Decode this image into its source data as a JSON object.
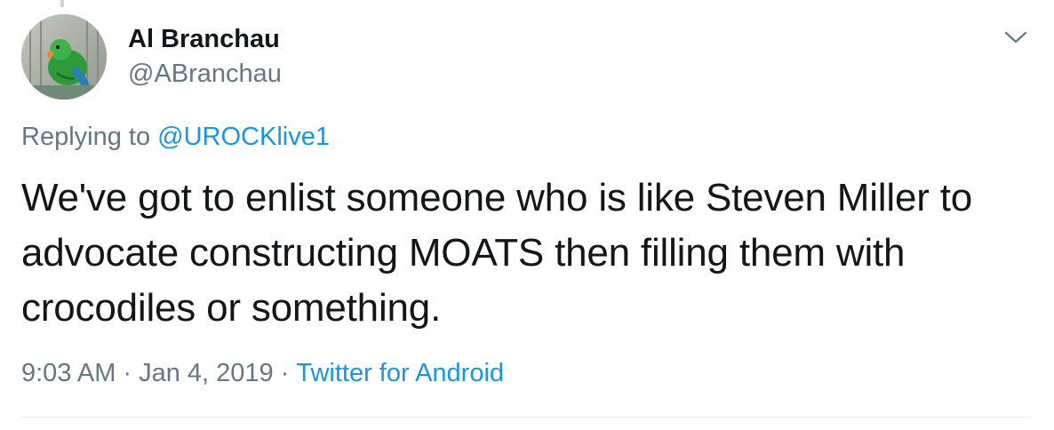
{
  "tweet": {
    "author": {
      "display_name": "Al Branchau",
      "handle": "@ABranchau",
      "avatar": "parrot-avatar"
    },
    "reply_prefix": "Replying to",
    "reply_to": "@UROCKlive1",
    "text": "We've got to enlist someone who is like Steven Miller to advocate constructing MOATS then filling them with crocodiles or something.",
    "time": "9:03 AM",
    "separator": "·",
    "date": "Jan 4, 2019",
    "source": "Twitter for Android"
  },
  "icons": {
    "menu": "chevron-down-icon"
  },
  "colors": {
    "text": "#14171a",
    "secondary": "#657786",
    "link": "#1b95e0",
    "divider": "#e6ecf0"
  }
}
